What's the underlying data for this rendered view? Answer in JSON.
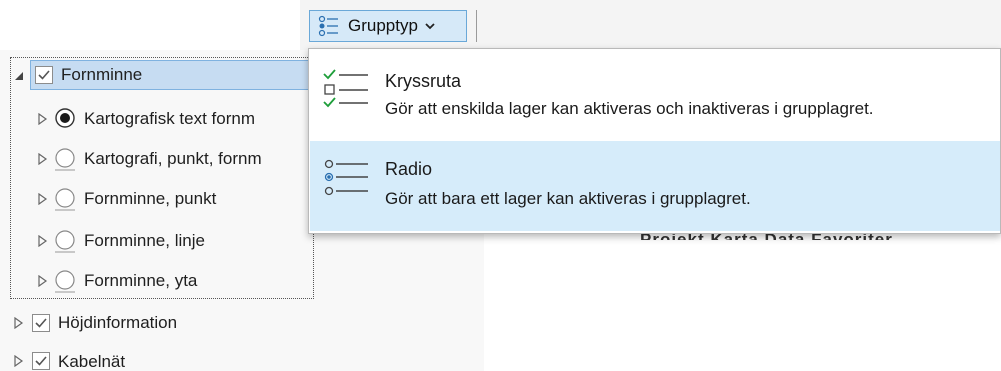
{
  "ribbon": {
    "grupptyp_label": "Grupptyp"
  },
  "tree": {
    "group": {
      "label": "Fornminne",
      "checked": true
    },
    "children": [
      {
        "label": "Kartografisk text fornm",
        "radio": "filled"
      },
      {
        "label": "Kartografi, punkt, fornm",
        "radio": "empty"
      },
      {
        "label": "Fornminne, punkt",
        "radio": "empty"
      },
      {
        "label": "Fornminne, linje",
        "radio": "empty"
      },
      {
        "label": "Fornminne, yta",
        "radio": "empty"
      }
    ],
    "siblings": [
      {
        "label": "Höjdinformation",
        "checked": true
      },
      {
        "label": "Kabelnät",
        "checked": true
      }
    ]
  },
  "dropdown": {
    "options": [
      {
        "title": "Kryssruta",
        "description": "Gör att enskilda lager kan aktiveras och inaktiveras i grupplagret."
      },
      {
        "title": "Radio",
        "description": "Gör att bara ett lager kan aktiveras i grupplagret."
      }
    ]
  },
  "background": {
    "partial_text": "Projekt  Karta  Data  Favoriter"
  },
  "colors": {
    "accent_blue": "#6aa8d8",
    "selection": "#c6dcf2",
    "highlight": "#d6ecfa",
    "check_green": "#1e9e3a"
  }
}
